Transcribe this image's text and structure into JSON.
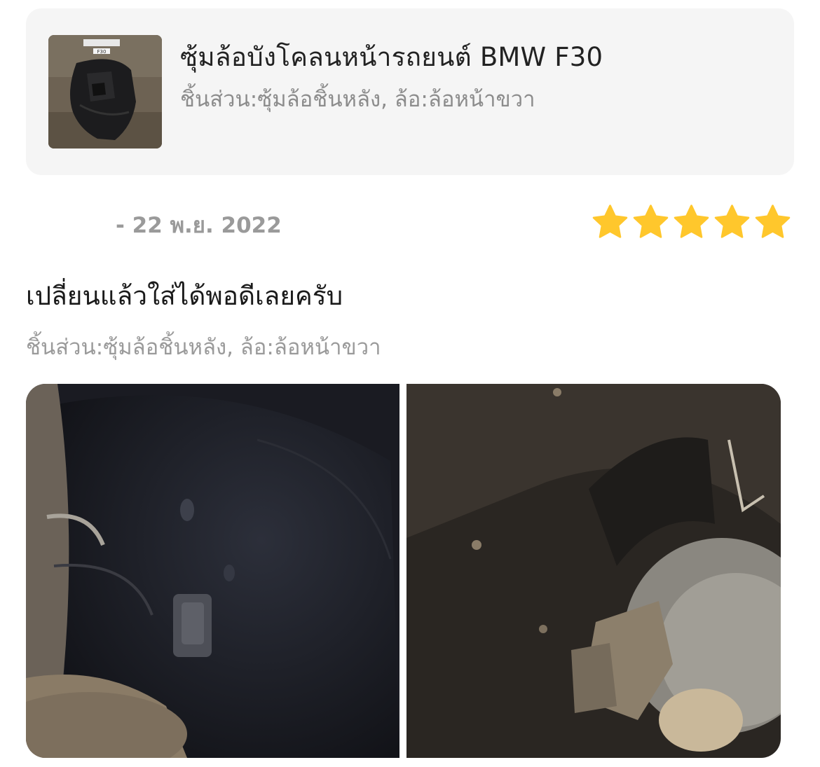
{
  "product": {
    "title": "ซุ้มล้อบังโคลนหน้ารถยนต์ BMW F30",
    "variant": "ชิ้นส่วน:ซุ้มล้อชิ้นหลัง, ล้อ:ล้อหน้าขวา",
    "thumbnail_caption": "F30"
  },
  "review": {
    "date": "- 22 พ.ย. 2022",
    "rating": 5,
    "max_rating": 5,
    "text": "เปลี่ยนแล้วใส่ได้พอดีเลยครับ",
    "variant": "ชิ้นส่วน:ซุ้มล้อชิ้นหลัง, ล้อ:ล้อหน้าขวา",
    "star_color": "#ffc72c"
  },
  "photos": [
    {
      "icon": "wheel-well-liner-photo-1"
    },
    {
      "icon": "wheel-well-liner-photo-2"
    }
  ]
}
